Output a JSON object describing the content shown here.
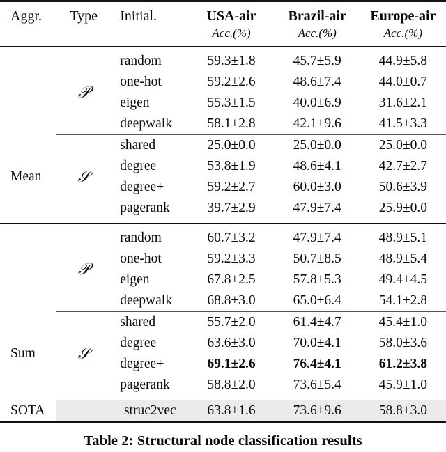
{
  "table": {
    "label": "Table 2",
    "caption": "Table 2: Structural node classification results",
    "headers": {
      "aggr": "Aggr.",
      "type": "Type",
      "initial": "Initial.",
      "datasets": [
        {
          "name": "USA-air",
          "metric": "Acc.(%)"
        },
        {
          "name": "Brazil-air",
          "metric": "Acc.(%)"
        },
        {
          "name": "Europe-air",
          "metric": "Acc.(%)"
        }
      ]
    },
    "groups": [
      {
        "aggr": "Mean",
        "subgroups": [
          {
            "type": "ᵋP",
            "type_symbol": "𝒫",
            "rows": [
              {
                "initial": "random",
                "values": [
                  "59.3±1.8",
                  "45.7±5.9",
                  "44.9±5.8"
                ],
                "bold": [
                  false,
                  false,
                  false
                ]
              },
              {
                "initial": "one-hot",
                "values": [
                  "59.2±2.6",
                  "48.6±7.4",
                  "44.0±0.7"
                ],
                "bold": [
                  false,
                  false,
                  false
                ]
              },
              {
                "initial": "eigen",
                "values": [
                  "55.3±1.5",
                  "40.0±6.9",
                  "31.6±2.1"
                ],
                "bold": [
                  false,
                  false,
                  false
                ]
              },
              {
                "initial": "deepwalk",
                "values": [
                  "58.1±2.8",
                  "42.1±9.6",
                  "41.5±3.3"
                ],
                "bold": [
                  false,
                  false,
                  false
                ]
              }
            ]
          },
          {
            "type": "S",
            "type_symbol": "𝒮",
            "rows": [
              {
                "initial": "shared",
                "values": [
                  "25.0±0.0",
                  "25.0±0.0",
                  "25.0±0.0"
                ],
                "bold": [
                  false,
                  false,
                  false
                ]
              },
              {
                "initial": "degree",
                "values": [
                  "53.8±1.9",
                  "48.6±4.1",
                  "42.7±2.7"
                ],
                "bold": [
                  false,
                  false,
                  false
                ]
              },
              {
                "initial": "degree+",
                "values": [
                  "59.2±2.7",
                  "60.0±3.0",
                  "50.6±3.9"
                ],
                "bold": [
                  false,
                  false,
                  false
                ]
              },
              {
                "initial": "pagerank",
                "values": [
                  "39.7±2.9",
                  "47.9±7.4",
                  "25.9±0.0"
                ],
                "bold": [
                  false,
                  false,
                  false
                ]
              }
            ]
          }
        ]
      },
      {
        "aggr": "Sum",
        "subgroups": [
          {
            "type": "P",
            "type_symbol": "𝒫",
            "rows": [
              {
                "initial": "random",
                "values": [
                  "60.7±3.2",
                  "47.9±7.4",
                  "48.9±5.1"
                ],
                "bold": [
                  false,
                  false,
                  false
                ]
              },
              {
                "initial": "one-hot",
                "values": [
                  "59.2±3.3",
                  "50.7±8.5",
                  "48.9±5.4"
                ],
                "bold": [
                  false,
                  false,
                  false
                ]
              },
              {
                "initial": "eigen",
                "values": [
                  "67.8±2.5",
                  "57.8±5.3",
                  "49.4±4.5"
                ],
                "bold": [
                  false,
                  false,
                  false
                ]
              },
              {
                "initial": "deepwalk",
                "values": [
                  "68.8±3.0",
                  "65.0±6.4",
                  "54.1±2.8"
                ],
                "bold": [
                  false,
                  false,
                  false
                ]
              }
            ]
          },
          {
            "type": "S",
            "type_symbol": "𝒮",
            "rows": [
              {
                "initial": "shared",
                "values": [
                  "55.7±2.0",
                  "61.4±4.7",
                  "45.4±1.0"
                ],
                "bold": [
                  false,
                  false,
                  false
                ]
              },
              {
                "initial": "degree",
                "values": [
                  "63.6±3.0",
                  "70.0±4.1",
                  "58.0±3.6"
                ],
                "bold": [
                  false,
                  false,
                  false
                ]
              },
              {
                "initial": "degree+",
                "values": [
                  "69.1±2.6",
                  "76.4±4.1",
                  "61.2±3.8"
                ],
                "bold": [
                  true,
                  true,
                  true
                ]
              },
              {
                "initial": "pagerank",
                "values": [
                  "58.8±2.0",
                  "73.6±5.4",
                  "45.9±1.0"
                ],
                "bold": [
                  false,
                  false,
                  false
                ]
              }
            ]
          }
        ]
      }
    ],
    "sota": {
      "aggr": "SOTA",
      "method": "struc2vec",
      "values": [
        "63.8±1.6",
        "73.6±9.6",
        "58.8±3.0"
      ],
      "highlight_color": "#ebebeb"
    }
  }
}
